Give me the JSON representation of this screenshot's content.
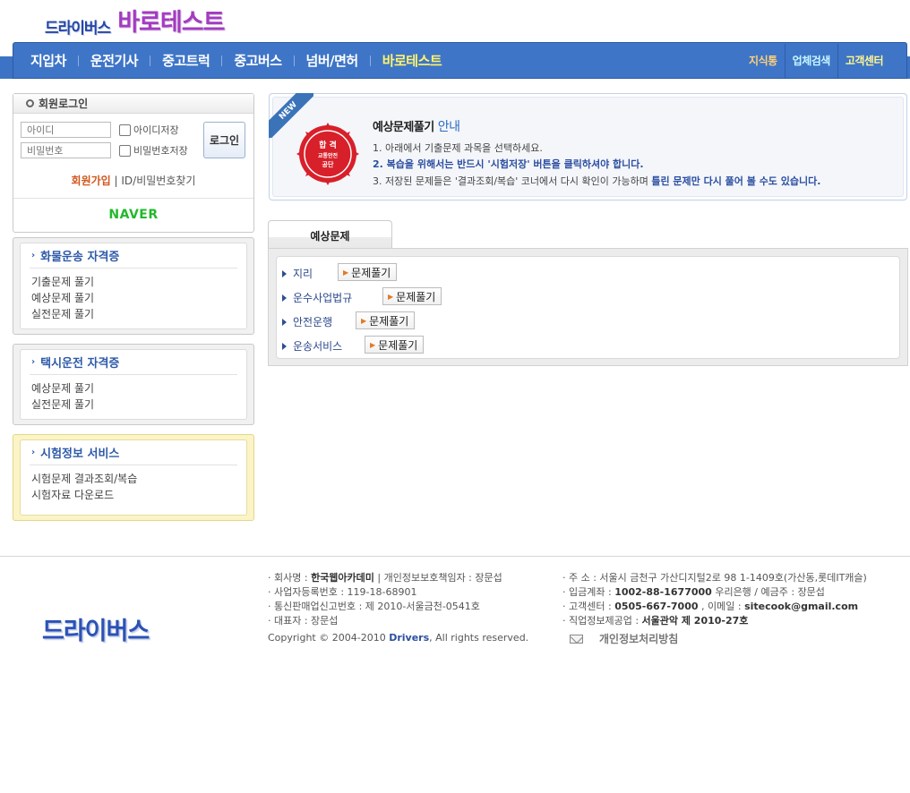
{
  "header": {
    "logo_part1": "드라이버스",
    "logo_part2": "바로테스트"
  },
  "nav": {
    "items": [
      "지입차",
      "운전기사",
      "중고트럭",
      "중고버스",
      "넘버/면허",
      "바로테스트"
    ],
    "right_items": [
      "지식통",
      "업체검색",
      "고객센터"
    ]
  },
  "login": {
    "title": "회원로그인",
    "id_placeholder": "아이디",
    "pw_placeholder": "비밀번호",
    "save_id_label": "아이디저장",
    "save_pw_label": "비밀번호저장",
    "login_button": "로그인",
    "join_label": "회원가입",
    "find_label": "ID/비밀번호찾기",
    "naver_label": "NAVER"
  },
  "sidebar": {
    "truck": {
      "title": "화물운송 자격증",
      "items": [
        "기출문제 풀기",
        "예상문제 풀기",
        "실전문제 풀기"
      ]
    },
    "taxi": {
      "title": "택시운전 자격증",
      "items": [
        "예상문제 풀기",
        "실전문제 풀기"
      ]
    },
    "exam_info": {
      "title": "시험정보 서비스",
      "items": [
        "시험문제 결과조회/복습",
        "시험자료 다운로드"
      ]
    }
  },
  "notice": {
    "badge": "NEW",
    "seal_line1": "합 격",
    "seal_line2": "교통안전",
    "seal_line3": "공단",
    "title_bold": "예상문제풀기",
    "title_light": "안내",
    "line1": "1. 아래에서 기출문제 과목을 선택하세요.",
    "line2": "2. 복습을 위해서는 반드시 '시험저장' 버튼을 클릭하셔야 합니다.",
    "line3_prefix": "3. 저장된 문제들은 '결과조회/복습' 코너에서 다시 확인이 가능하며",
    "line3_bold": "틀린 문제만 다시 풀어 볼 수도 있습니다."
  },
  "tab": {
    "label": "예상문제",
    "subjects": [
      {
        "name": "지리",
        "button": "문제풀기"
      },
      {
        "name": "운수사업법규",
        "button": "문제풀기"
      },
      {
        "name": "안전운행",
        "button": "문제풀기"
      },
      {
        "name": "운송서비스",
        "button": "문제풀기"
      }
    ]
  },
  "footer": {
    "logo": "드라이버스",
    "company_label": "· 회사명 :",
    "company_name": "한국웹아카데미",
    "company_rest": " | 개인정보보호책임자 : 장문섭",
    "bizno": "· 사업자등록번호 : 119-18-68901",
    "mailorder": "· 통신판매업신고번호 : 제 2010-서울금천-0541호",
    "ceo": "· 대표자 : 장문섭",
    "copyright_prefix": "Copyright © 2004-2010",
    "copyright_brand": "Drivers",
    "copyright_suffix": ", All rights reserved.",
    "address": "· 주 소 : 서울시 금천구 가산디지털2로 98 1-1409호(가산동,롯데IT캐슬)",
    "account_label": "· 입금계좌 :",
    "account_no": "1002-88-1677000",
    "account_rest": " 우리은행 / 예금주 : 장문섭",
    "cs_label": "· 고객센터 :",
    "cs_phone": "0505-667-7000",
    "cs_mid": " , 이메일 :",
    "cs_email": "sitecook@gmail.com",
    "job_label": "· 직업정보제공업 :",
    "job_no": "서울관악 제 2010-27호",
    "privacy": "개인정보처리방침"
  },
  "colors": {
    "nav_bg": "#3e75c7",
    "nav_highlight": "#fff36a",
    "link_blue": "#2e5aa8",
    "join_orange": "#d2561a",
    "naver_green": "#22b82d",
    "seal_red": "#d8202a"
  }
}
